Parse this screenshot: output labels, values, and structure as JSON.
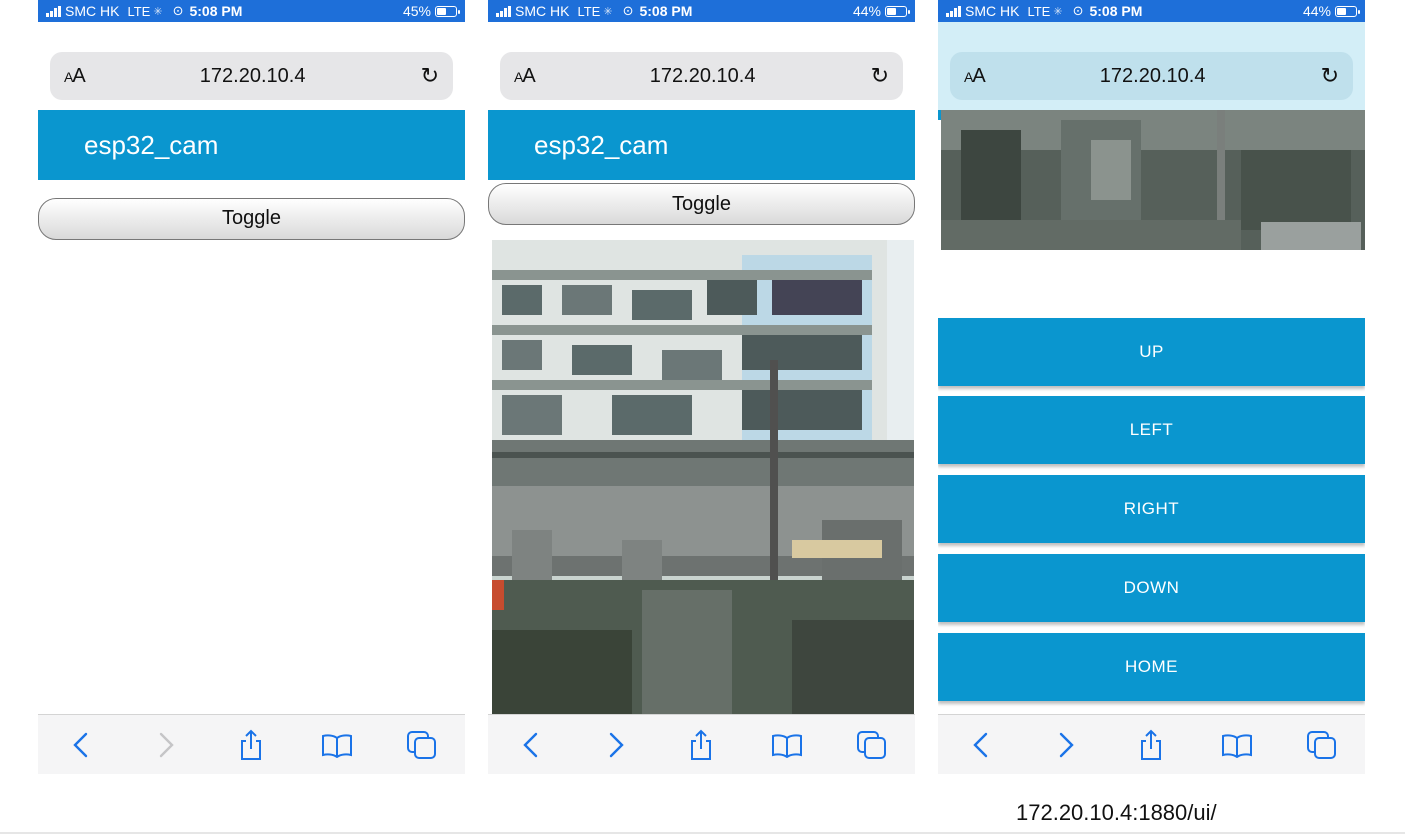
{
  "screens": [
    {
      "status": {
        "carrier": "SMC HK",
        "network": "LTE",
        "time": "5:08 PM",
        "battery": "45%"
      },
      "url": "172.20.10.4",
      "aa_label": "AA",
      "header_title": "esp32_cam",
      "toggle_label": "Toggle"
    },
    {
      "status": {
        "carrier": "SMC HK",
        "network": "LTE",
        "time": "5:08 PM",
        "battery": "44%"
      },
      "url": "172.20.10.4",
      "aa_label": "AA",
      "header_title": "esp32_cam",
      "toggle_label": "Toggle"
    },
    {
      "status": {
        "carrier": "SMC HK",
        "network": "LTE",
        "time": "5:08 PM",
        "battery": "44%"
      },
      "url": "172.20.10.4",
      "aa_label": "AA",
      "controls": [
        "UP",
        "LEFT",
        "RIGHT",
        "DOWN",
        "HOME"
      ]
    }
  ],
  "caption": "172.20.10.4:1880/ui/",
  "colors": {
    "accent": "#0a96cf",
    "status_bar": "#1e6fd9",
    "url_bar": "#e6e6e8",
    "toolbar_icon": "#1a73e8"
  },
  "icons": [
    "signal-icon",
    "loading-icon",
    "link-icon",
    "battery-icon",
    "reload-icon",
    "back-icon",
    "forward-icon",
    "share-icon",
    "bookmarks-icon",
    "tabs-icon"
  ]
}
